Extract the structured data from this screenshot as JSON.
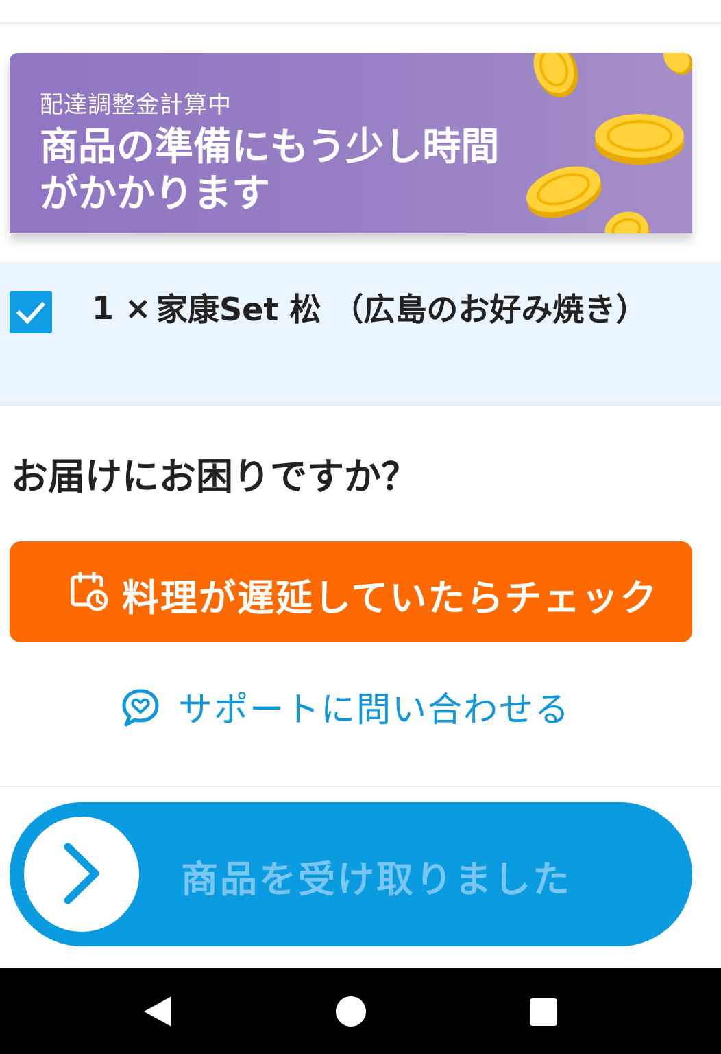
{
  "banner": {
    "subtitle": "配達調整金計算中",
    "title": "商品の準備にもう少し時間がかかります"
  },
  "order": {
    "checked": true,
    "quantity": "1 ×",
    "item_name": "家康Set 松 （広島のお好み焼き）"
  },
  "help": {
    "heading": "お届けにお困りですか？",
    "check_delay_label": "料理が遅延していたらチェック",
    "support_label": "サポートに問い合わせる"
  },
  "slider": {
    "label": "商品を受け取りました"
  },
  "icons": {
    "calendar": "calendar-clock-icon",
    "support": "chat-heart-icon",
    "slider": "chevron-right-icon",
    "coins": "coin-icon",
    "nav_back": "back-triangle-icon",
    "nav_home": "home-circle-icon",
    "nav_recents": "recents-square-icon"
  },
  "colors": {
    "banner_start": "#8f75c2",
    "banner_end": "#a58ec9",
    "orange": "#ff6a00",
    "blue": "#0a9be0",
    "link_blue": "#0e97da",
    "item_bg": "#eaf4fc"
  }
}
